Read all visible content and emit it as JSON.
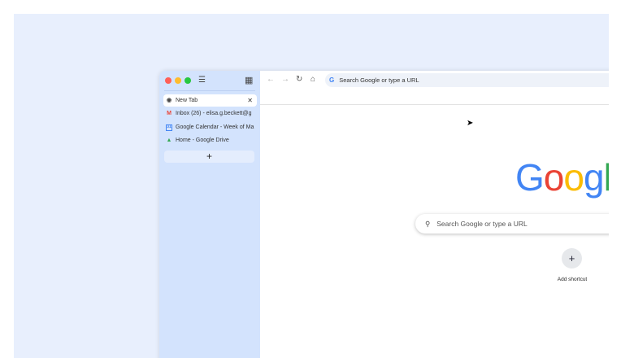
{
  "sidebar": {
    "tabs": [
      {
        "label": "New Tab",
        "favicon": "chrome-icon",
        "active": true
      },
      {
        "label": "Inbox (26) - elisa.g.beckett@g",
        "favicon": "gmail-icon"
      },
      {
        "label": "Google Calendar - Week of Ma",
        "favicon": "calendar-icon"
      },
      {
        "label": "Home - Google Drive",
        "favicon": "drive-icon"
      }
    ],
    "new_tab_label": "+"
  },
  "toolbar": {
    "omnibox_placeholder": "Search Google or type a URL"
  },
  "ntp": {
    "logo": "Google",
    "search_placeholder": "Search Google or type a URL",
    "add_shortcut_label": "Add shortcut",
    "add_shortcut_icon": "+"
  },
  "colors": {
    "sidebar": "#d3e3fd",
    "background": "#e8effd"
  }
}
